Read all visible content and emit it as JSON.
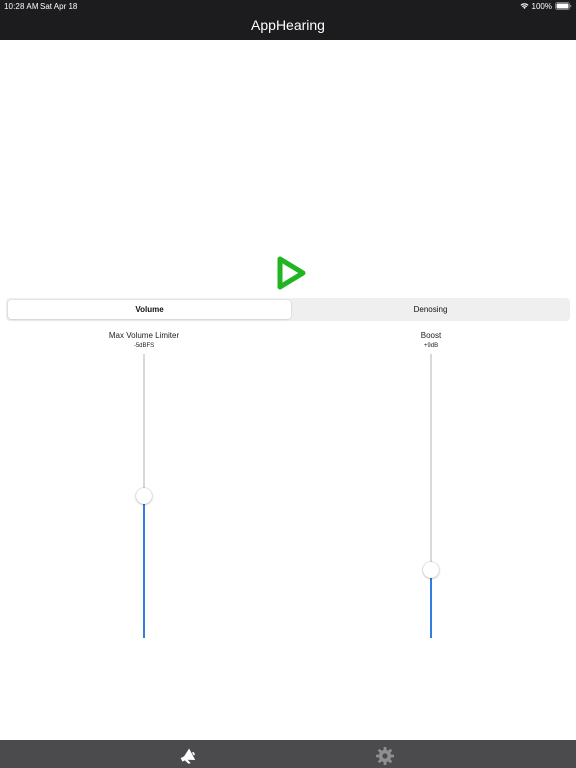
{
  "status_bar": {
    "time": "10:28 AM",
    "date": "Sat Apr 18",
    "battery": "100%"
  },
  "nav": {
    "title": "AppHearing"
  },
  "play": {
    "icon": "play-icon",
    "color": "#22b522"
  },
  "segments": {
    "items": [
      {
        "label": "Volume",
        "selected": true
      },
      {
        "label": "Denosing",
        "selected": false
      }
    ]
  },
  "sliders": {
    "left": {
      "title": "Max Volume Limiter",
      "value_text": "-5dBFS",
      "level": 0.5,
      "accent": "#2f7fe0"
    },
    "right": {
      "title": "Boost",
      "value_text": "+9dB",
      "level": 0.24,
      "accent": "#2f7fe0"
    }
  },
  "tab_bar": {
    "items": [
      {
        "icon": "megaphone-icon",
        "selected": true
      },
      {
        "icon": "gear-icon",
        "selected": false
      }
    ],
    "selected_color": "#ffffff",
    "unselected_color": "#8e8e93"
  }
}
